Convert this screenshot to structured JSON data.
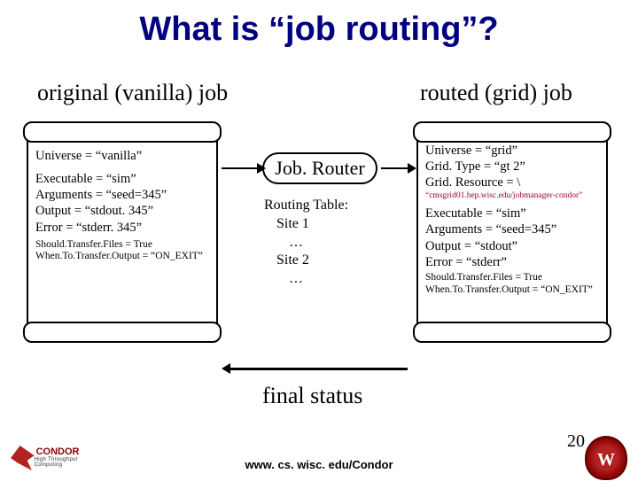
{
  "title": "What is “job routing”?",
  "left_label": "original (vanilla) job",
  "right_label": "routed (grid) job",
  "left_scroll": {
    "l1": "Universe = “vanilla”",
    "l2": "Executable = “sim”",
    "l3": "Arguments = “seed=345”",
    "l4": "Output = “stdout. 345”",
    "l5": "Error = “stderr. 345”",
    "l6": "Should.Transfer.Files = True",
    "l7": "When.To.Transfer.Output = “ON_EXIT”"
  },
  "router": {
    "label": "Job. Router",
    "table_title": "Routing Table:",
    "site1": "Site 1",
    "site2": "Site 2",
    "dots": "…"
  },
  "right_scroll": {
    "l1": "Universe = “grid”",
    "l2": "Grid. Type = “gt 2”",
    "l3": "Grid. Resource = \\",
    "l4": "“cmsgrid01.hep.wisc.edu/jobmanager-condor”",
    "l5": "Executable = “sim”",
    "l6": "Arguments = “seed=345”",
    "l7": "Output = “stdout”",
    "l8": "Error = “stderr”",
    "l9": "Should.Transfer.Files = True",
    "l10": "When.To.Transfer.Output = “ON_EXIT”"
  },
  "final_status": "final status",
  "footer_url": "www. cs. wisc. edu/Condor",
  "page": "20",
  "logo_left": {
    "name": "CONDOR",
    "sub": "High Throughput Computing"
  }
}
